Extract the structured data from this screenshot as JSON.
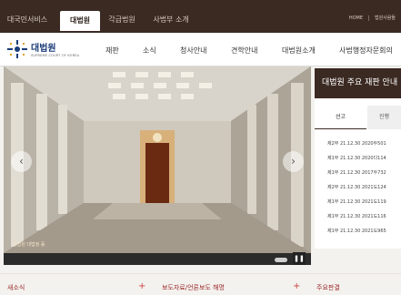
{
  "topbar": {
    "tabs": [
      "대국민서비스",
      "대법원",
      "각급법원",
      "사법부 소개"
    ],
    "right_links": [
      "HOME",
      "법원사람들"
    ]
  },
  "header": {
    "logo_title": "대법원",
    "logo_sub": "SUPREME COURT OF KOREA",
    "nav": [
      "재판",
      "소식",
      "청사안내",
      "견학안내",
      "대법원소개",
      "사법행정자문회의"
    ]
  },
  "hero": {
    "caption": "대법원 대법정 홀",
    "prev_icon": "‹",
    "next_icon": "›",
    "pause_icon": "❚❚"
  },
  "panel": {
    "title": "대법원 주요 재판 안내",
    "tabs": [
      "선고",
      "진행"
    ],
    "rows": [
      {
        "div": "제2부",
        "date": "21.12.30",
        "case": "2020두501"
      },
      {
        "div": "제1부",
        "date": "21.12.30",
        "case": "2020다114"
      },
      {
        "div": "제1부",
        "date": "21.12.30",
        "case": "2017두732"
      },
      {
        "div": "제2부",
        "date": "21.12.30",
        "case": "2021도124"
      },
      {
        "div": "제1부",
        "date": "21.12.30",
        "case": "2021도119"
      },
      {
        "div": "제1부",
        "date": "21.12.30",
        "case": "2021도116"
      },
      {
        "div": "제1부",
        "date": "21.12.30",
        "case": "2021도965"
      }
    ]
  },
  "bottom": {
    "items": [
      "새소식",
      "보도자료/언론보도 해명",
      "주요판결"
    ],
    "plus_icon": "+"
  },
  "colors": {
    "brand_dark": "#3b2a22",
    "accent_red": "#9a2a2a",
    "logo_blue": "#1b3d79"
  }
}
